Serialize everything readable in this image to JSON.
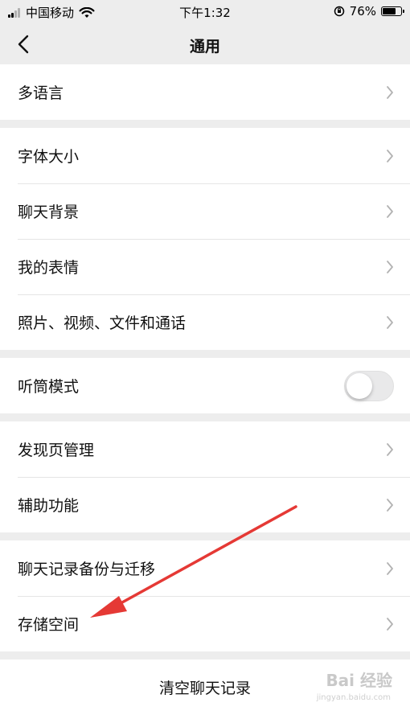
{
  "status_bar": {
    "carrier": "中国移动",
    "time": "下午1:32",
    "battery_percent": "76%",
    "battery_level": 0.76,
    "signal_icon": "signal-icon",
    "wifi_icon": "wifi-icon",
    "rotation_lock_icon": "rotation-lock-icon"
  },
  "nav": {
    "title": "通用",
    "back_icon": "back-arrow-icon"
  },
  "groups": [
    {
      "items": [
        {
          "label": "多语言"
        }
      ]
    },
    {
      "items": [
        {
          "label": "字体大小"
        },
        {
          "label": "聊天背景"
        },
        {
          "label": "我的表情"
        },
        {
          "label": "照片、视频、文件和通话"
        }
      ]
    },
    {
      "items": [
        {
          "label": "听筒模式",
          "toggle": false
        }
      ]
    },
    {
      "items": [
        {
          "label": "发现页管理"
        },
        {
          "label": "辅助功能"
        }
      ]
    },
    {
      "items": [
        {
          "label": "聊天记录备份与迁移"
        },
        {
          "label": "存储空间"
        }
      ]
    }
  ],
  "clear_button": {
    "label": "清空聊天记录"
  },
  "annotation": {
    "color": "#e53935",
    "points_to": "存储空间"
  },
  "watermark": {
    "text": "Bai 经验",
    "sub": "jingyan.baidu.com"
  }
}
